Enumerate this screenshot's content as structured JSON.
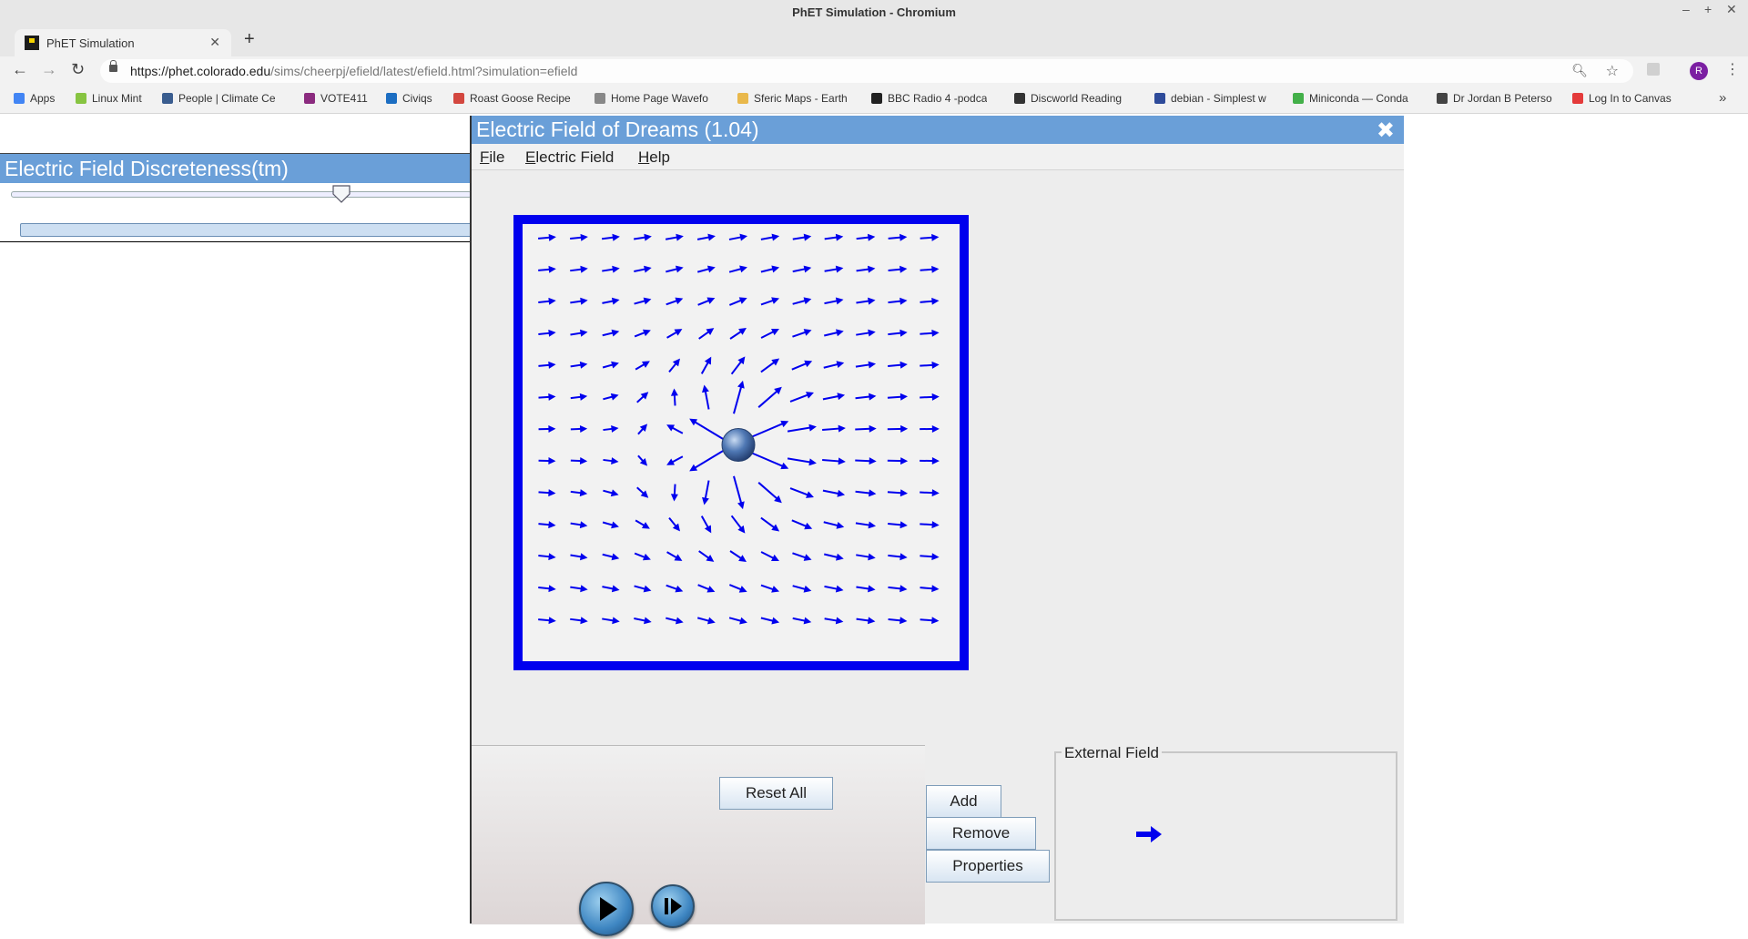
{
  "window": {
    "title": "PhET Simulation - Chromium"
  },
  "tab": {
    "title": "PhET Simulation"
  },
  "address": {
    "host": "https://phet.colorado.edu",
    "path": "/sims/cheerpj/efield/latest/efield.html?simulation=efield"
  },
  "bookmarks": [
    {
      "label": "Apps",
      "color": "#4285f4"
    },
    {
      "label": "Linux Mint",
      "color": "#87c441"
    },
    {
      "label": "People | Climate Ce",
      "color": "#3a5d8f"
    },
    {
      "label": "VOTE411",
      "color": "#8b2b7f"
    },
    {
      "label": "Civiqs",
      "color": "#1c6ec2"
    },
    {
      "label": "Roast Goose Recipe",
      "color": "#d3473f"
    },
    {
      "label": "Home Page Wavefo",
      "color": "#888888"
    },
    {
      "label": "Sferic Maps - Earth",
      "color": "#e9b84b"
    },
    {
      "label": "BBC Radio 4 -podca",
      "color": "#222222"
    },
    {
      "label": "Discworld Reading",
      "color": "#333333"
    },
    {
      "label": "debian - Simplest w",
      "color": "#2e4b9a"
    },
    {
      "label": "Miniconda — Conda",
      "color": "#43b049"
    },
    {
      "label": "Dr Jordan B Peterso",
      "color": "#444444"
    },
    {
      "label": "Log In to Canvas",
      "color": "#e43a3a"
    }
  ],
  "left_panel": {
    "title": "Electric Field Discreteness(tm)",
    "slider_level": 0.72
  },
  "sim": {
    "title": "Electric Field of Dreams (1.04)",
    "menu": [
      "File",
      "Electric Field",
      "Help"
    ],
    "reset_label": "Reset All",
    "add_label": "Add",
    "remove_label": "Remove",
    "properties_label": "Properties",
    "external_field_label": "External Field",
    "field_color": "#0000ee",
    "grid": {
      "cols": 13,
      "rows": 13
    },
    "charge": {
      "col": 6,
      "row": 6.5
    }
  }
}
